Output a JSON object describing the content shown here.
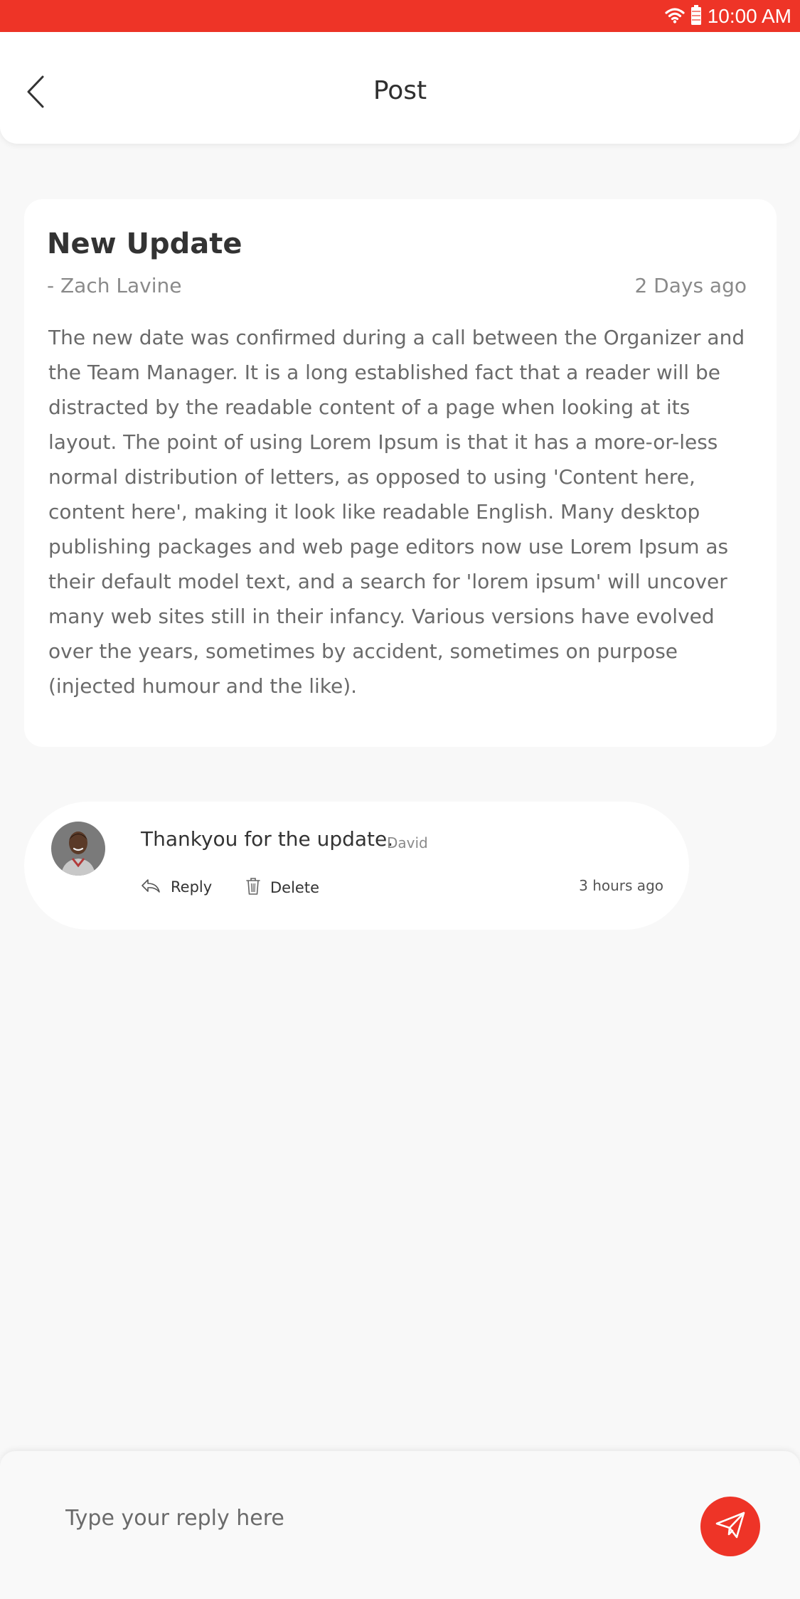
{
  "status_bar": {
    "time": "10:00 AM",
    "icons": [
      "wifi-icon",
      "battery-icon"
    ],
    "color": "#ee3427"
  },
  "header": {
    "title": "Post",
    "back_icon": "chevron-left-icon"
  },
  "post": {
    "title": "New Update",
    "author": "- Zach Lavine",
    "time": "2 Days ago",
    "body": "The new date was confirmed during a call between the Organizer  and the Team Manager. It is a long established fact that a reader will be distracted by the readable content of a page when looking at its layout. The point of using Lorem Ipsum is that it has a more-or-less normal distribution of letters, as opposed to using 'Content here, content here', making it look like readable English. Many desktop publishing packages and web page editors now use Lorem Ipsum as their default model text, and a search for 'lorem ipsum' will uncover many web sites still in their infancy. Various versions have evolved over the years, sometimes by accident, sometimes on purpose (injected humour and the like)."
  },
  "comments": [
    {
      "text": "Thankyou for the update.",
      "author": "David",
      "time": "3 hours ago",
      "reply_label": "Reply",
      "delete_label": "Delete",
      "icons": [
        "avatar",
        "reply-icon",
        "trash-icon"
      ]
    }
  ],
  "reply_bar": {
    "placeholder": "Type your reply here",
    "send_icon": "send-icon",
    "accent_color": "#ee3427"
  }
}
